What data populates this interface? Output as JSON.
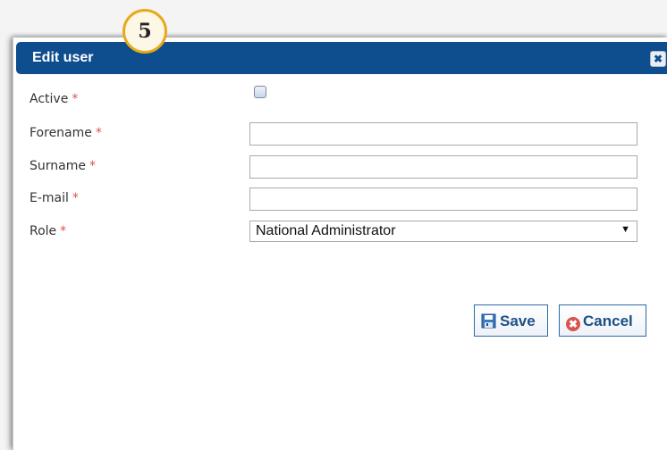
{
  "step_badge": "5",
  "dialog": {
    "title": "Edit user",
    "close_symbol": "✖"
  },
  "form": {
    "required_marker": "*",
    "active": {
      "label": "Active",
      "checked": false
    },
    "forename": {
      "label": "Forename",
      "value": ""
    },
    "surname": {
      "label": "Surname",
      "value": ""
    },
    "email": {
      "label": "E-mail",
      "value": ""
    },
    "role": {
      "label": "Role",
      "value": "National Administrator",
      "arrow": "▼"
    }
  },
  "buttons": {
    "save": {
      "label": "Save",
      "icon": "save-icon"
    },
    "cancel": {
      "label": "Cancel",
      "icon": "cancel-icon",
      "icon_symbol": "✖"
    }
  },
  "colors": {
    "titlebar": "#0e4d8e",
    "required": "#d9534f",
    "badge_border": "#e8a91b",
    "button_text": "#1d4f86"
  }
}
